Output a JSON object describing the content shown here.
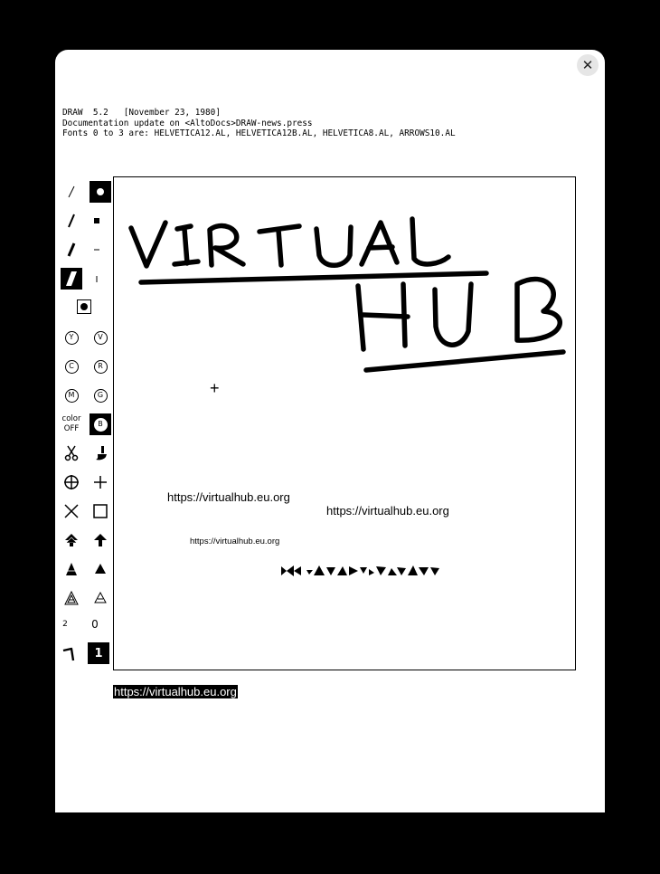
{
  "header": {
    "line1": "DRAW  5.2   [November 23, 1980]",
    "line2": "Documentation update on <AltoDocs>DRAW-news.press",
    "line3": "Fonts 0 to 3 are: HELVETICA12.AL, HELVETICA12B.AL, HELVETICA8.AL, ARROWS10.AL"
  },
  "window": {
    "close_label": "✕"
  },
  "canvas": {
    "url_line1": "https://virtualhub.eu.org",
    "url_line2": "https://virtualhub.eu.org",
    "url_line3": "https://virtualhub.eu.org",
    "handwriting_word1": "VIRTUAL",
    "handwriting_word2": "HUB",
    "cursor": "+"
  },
  "toolbar": {
    "color_label": "color",
    "color_state": "OFF",
    "font_y": "Y",
    "font_v": "V",
    "font_c": "C",
    "font_r": "R",
    "font_m": "M",
    "font_g": "G",
    "font_b": "B",
    "number_small": "2",
    "number_zero": "0",
    "number_one": "1"
  },
  "selection": {
    "text": "https://virtualhub.eu.org"
  },
  "colors": {
    "background": "#000000",
    "window": "#ffffff",
    "ink": "#000000"
  }
}
